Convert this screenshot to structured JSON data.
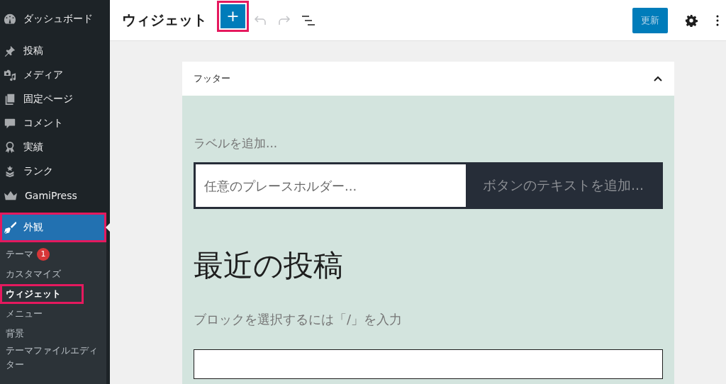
{
  "sidebar": {
    "items": [
      {
        "label": "ダッシュボード",
        "selected": false,
        "highlighted": false
      },
      {
        "label": "投稿",
        "selected": false,
        "highlighted": false
      },
      {
        "label": "メディア",
        "selected": false,
        "highlighted": false
      },
      {
        "label": "固定ページ",
        "selected": false,
        "highlighted": false
      },
      {
        "label": "コメント",
        "selected": false,
        "highlighted": false
      },
      {
        "label": "実績",
        "selected": false,
        "highlighted": false
      },
      {
        "label": "ランク",
        "selected": false,
        "highlighted": false
      },
      {
        "label": "GamiPress",
        "selected": false,
        "highlighted": false
      },
      {
        "label": "外観",
        "selected": true,
        "highlighted": true
      }
    ],
    "submenu": [
      {
        "label": "テーマ",
        "badge": "1",
        "selected": false,
        "highlighted": false
      },
      {
        "label": "カスタマイズ",
        "selected": false,
        "highlighted": false
      },
      {
        "label": "ウィジェット",
        "selected": true,
        "highlighted": true
      },
      {
        "label": "メニュー",
        "selected": false,
        "highlighted": false
      },
      {
        "label": "背景",
        "selected": false,
        "highlighted": false
      },
      {
        "label": "テーマファイルエディター",
        "selected": false,
        "highlighted": false
      }
    ]
  },
  "header": {
    "title": "ウィジェット",
    "inserter": {
      "label": "+",
      "highlighted": true
    },
    "update_button": "更新"
  },
  "widget_area": {
    "title": "フッター",
    "expanded": true,
    "search": {
      "label": "ラベルを追加...",
      "placeholder": "任意のプレースホルダー...",
      "button": "ボタンのテキストを追加..."
    },
    "heading": "最近の投稿",
    "prompt": "ブロックを選択するには「/」を入力"
  }
}
